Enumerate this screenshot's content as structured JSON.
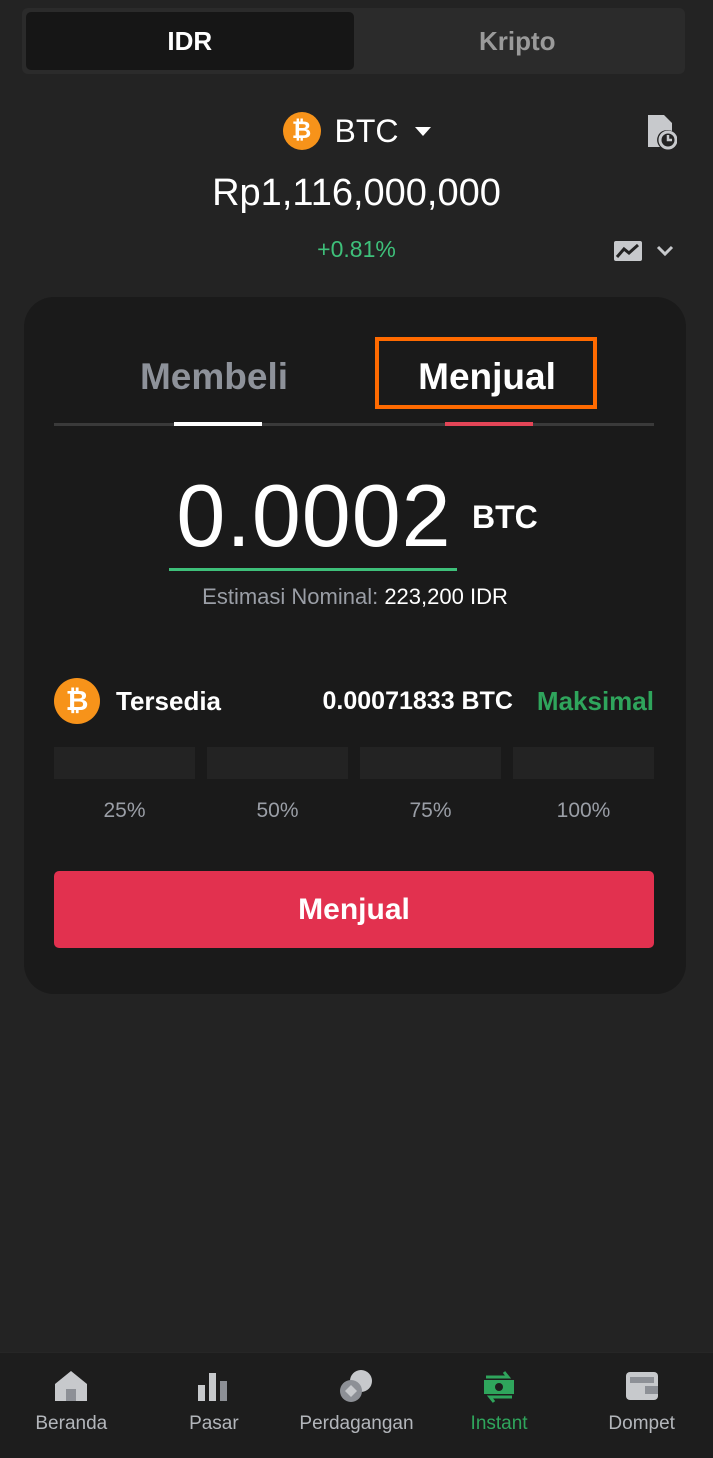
{
  "currency_toggle": {
    "tabs": [
      "IDR",
      "Kripto"
    ],
    "active": "IDR"
  },
  "coin": {
    "symbol": "BTC",
    "logo_glyph": "₿",
    "price": "Rp1,116,000,000",
    "change": "+0.81%"
  },
  "trade": {
    "tabs": {
      "buy": "Membeli",
      "sell": "Menjual"
    },
    "active_tab": "Menjual",
    "amount": "0.0002",
    "amount_unit": "BTC",
    "estimate_label": "Estimasi Nominal:",
    "estimate_value": " 223,200 IDR",
    "available_label": "Tersedia",
    "available_value": "0.00071833 BTC",
    "max_label": "Maksimal",
    "percent_options": [
      "25%",
      "50%",
      "75%",
      "100%"
    ],
    "submit_label": "Menjual"
  },
  "bottom_nav": {
    "items": [
      {
        "label": "Beranda",
        "icon": "home-icon"
      },
      {
        "label": "Pasar",
        "icon": "market-bars-icon"
      },
      {
        "label": "Perdagangan",
        "icon": "trade-coins-icon"
      },
      {
        "label": "Instant",
        "icon": "instant-exchange-icon"
      },
      {
        "label": "Dompet",
        "icon": "wallet-icon"
      }
    ],
    "active": "Instant"
  },
  "colors": {
    "background": "#232323",
    "card": "#1a1a1a",
    "accent_green": "#2fa55c",
    "accent_red": "#e2314f",
    "btc_orange": "#f7931a",
    "highlight_orange": "#ff6a00"
  }
}
